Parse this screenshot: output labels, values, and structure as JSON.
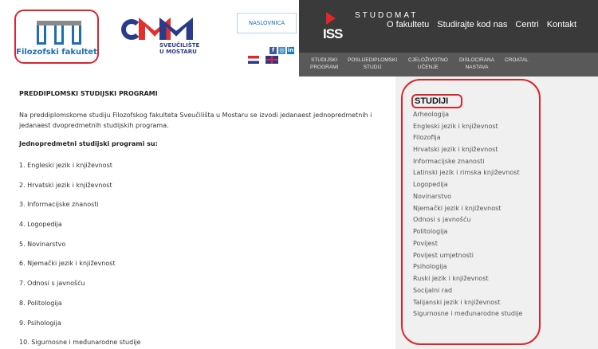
{
  "header": {
    "faculty_logo_text": "Filozofski fakultet",
    "university_logo_line1": "SVEUČILIŠTE",
    "university_logo_line2": "U MOSTARU",
    "home_button": "NASLOVNICA",
    "social": [
      "f",
      "◎",
      "in"
    ],
    "iss_text": "ISS",
    "studomat_text": "STUDOMAT",
    "top_nav": [
      "O fakultetu",
      "Studirajte kod nas",
      "Centri",
      "Kontakt"
    ],
    "sub_nav": [
      [
        "STUDIJSKI",
        "PROGRAMI"
      ],
      [
        "POSLIJEDIPLOMSKI",
        "STUDIJ"
      ],
      [
        "CJELOŽIVOTNO",
        "UČENJE"
      ],
      [
        "DISLOCIRANA",
        "NASTAVA"
      ],
      [
        "CROATAL",
        ""
      ]
    ],
    "colors": {
      "brand_blue": "#1d6fb0",
      "accent_red": "#d9262c",
      "dark_bar": "#3a3a3a"
    }
  },
  "main": {
    "title": "PREDDIPLOMSKI STUDIJSKI PROGRAMI",
    "intro_line1": "Na preddiplomskome studiju Filozofskog fakulteta Sveučilišta u Mostaru se izvodi jedanaest jednopredmetnih i",
    "intro_line2": "jedanaest dvopredmetnih studijskih programa.",
    "subtitle": "Jednopredmetni studijski programi su:",
    "programs": [
      "1. Engleski jezik i književnost",
      "2. Hrvatski jezik i književnost",
      "3. Informacijske znanosti",
      "4. Logopedija",
      "5. Novinarstvo",
      "6. Njemački jezik i književnost",
      "7. Odnosi s javnošću",
      "8. Politologija",
      "9. Psihologija",
      "10. Sigurnosne i međunarodne studije"
    ]
  },
  "sidebar": {
    "title": "STUDIJI",
    "items": [
      "Arheologija",
      "Engleski jezik i književnost",
      "Filozofija",
      "Hrvatski jezik i književnost",
      "Informacijske znanosti",
      "Latinski jezik i rimska književnost",
      "Logopedija",
      "Novinarstvo",
      "Njemački jezik i književnost",
      "Odnosi s javnošću",
      "Politologija",
      "Povijest",
      "Povijest umjetnosti",
      "Psihologija",
      "Ruski jezik i književnost",
      "Socijalni rad",
      "Talijanski jezik i književnost",
      "Sigurnosne i međunarodne studije"
    ]
  }
}
